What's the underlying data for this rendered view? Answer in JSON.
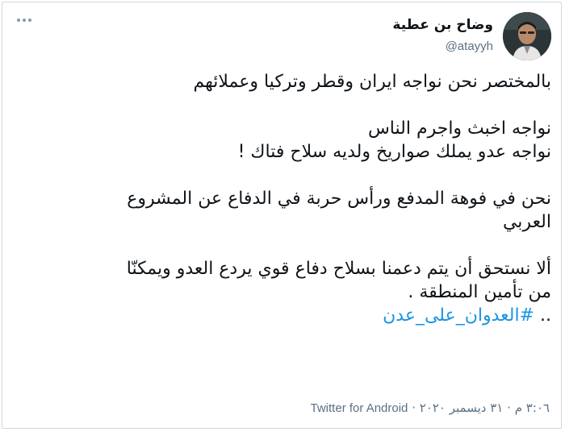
{
  "user": {
    "display_name": "وضاح بن عطية",
    "handle": "@atayyh"
  },
  "tweet": {
    "paragraphs": [
      [
        "بالمختصر نحن نواجه ايران وقطر وتركيا وعملائهم"
      ],
      [
        "نواجه اخبث واجرم الناس",
        "نواجه عدو يملك صواريخ ولديه سلاح فتاك !"
      ],
      [
        "نحن في فوهة المدفع ورأس حربة في الدفاع عن المشروع",
        "العربي"
      ],
      [
        "ألا نستحق أن يتم دعمنا بسلاح دفاع قوي يردع العدو ويمكنّا",
        "من تأمين المنطقة ."
      ]
    ],
    "hashtag_prefix": "..",
    "hashtag": "#العدوان_على_عدن"
  },
  "meta": {
    "time": "٣:٠٦ م",
    "date": "٣١ ديسمبر ٢٠٢٠",
    "separator": "·",
    "source": "Twitter for Android"
  },
  "icons": {
    "more": "more-dots-icon"
  },
  "colors": {
    "text": "#0f1419",
    "secondary": "#5b7083",
    "link": "#1b95e0",
    "border": "#cfd9de"
  }
}
